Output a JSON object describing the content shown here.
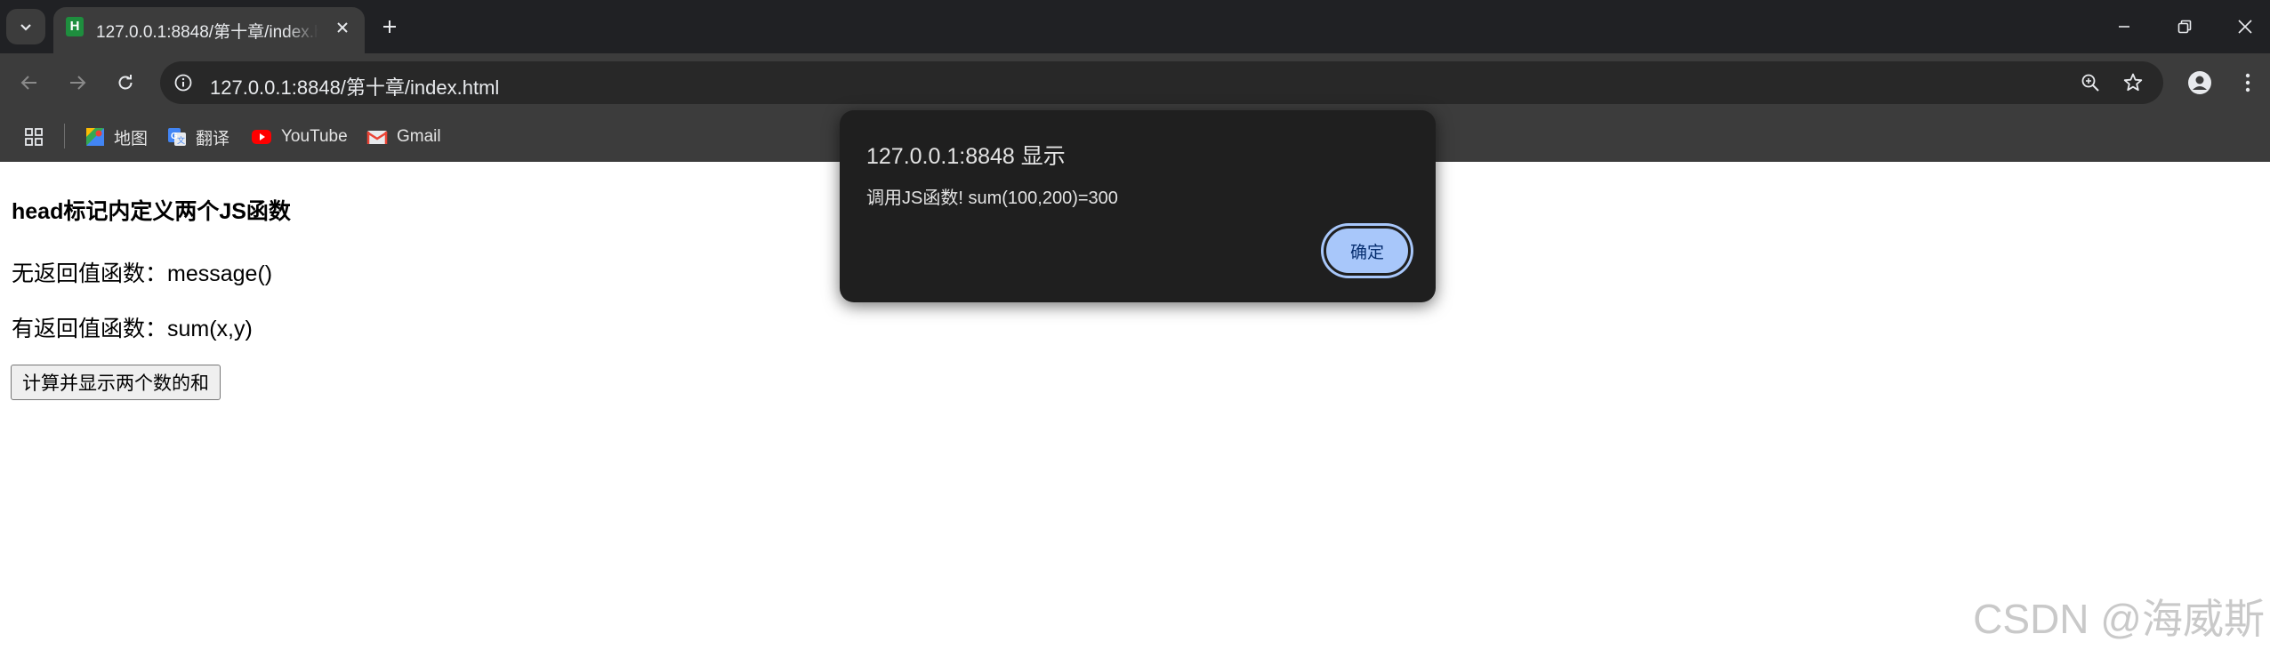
{
  "tab": {
    "title": "127.0.0.1:8848/第十章/index.html",
    "favicon_letter": "H"
  },
  "address_bar": {
    "url": "127.0.0.1:8848/第十章/index.html"
  },
  "bookmarks": [
    {
      "label": "地图",
      "icon": "maps-icon"
    },
    {
      "label": "翻译",
      "icon": "translate-icon"
    },
    {
      "label": "YouTube",
      "icon": "youtube-icon"
    },
    {
      "label": "Gmail",
      "icon": "gmail-icon"
    }
  ],
  "page": {
    "heading": "head标记内定义两个JS函数",
    "line1": "无返回值函数：message()",
    "line2": "有返回值函数：sum(x,y)",
    "button_label": "计算并显示两个数的和"
  },
  "dialog": {
    "title": "127.0.0.1:8848 显示",
    "message": "调用JS函数! sum(100,200)=300",
    "ok_label": "确定"
  },
  "watermark": "CSDN @海威斯",
  "colors": {
    "titlebar_bg": "#202124",
    "toolbar_bg": "#3c3c3c",
    "omnibox_bg": "#282828",
    "dialog_bg": "#1f1f1f",
    "dialog_button": "#a8c7fa"
  }
}
